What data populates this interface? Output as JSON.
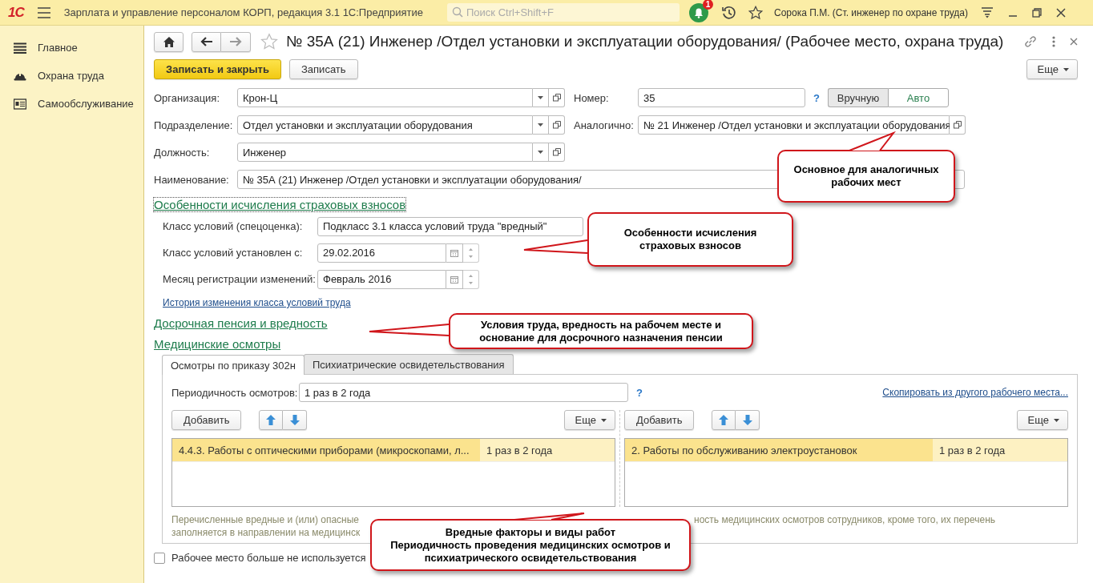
{
  "app_bar": {
    "logo": "1С",
    "title": "Зарплата и управление персоналом КОРП, редакция 3.1 1С:Предприятие",
    "search": {
      "placeholder": "Поиск Ctrl+Shift+F"
    },
    "notifications_badge": "1",
    "user": "Сорока П.М. (Ст. инженер по охране труда)"
  },
  "sidebar": {
    "items": [
      {
        "label": "Главное",
        "kind": "menu"
      },
      {
        "label": "Охрана труда",
        "kind": "helmet"
      },
      {
        "label": "Самообслуживание",
        "kind": "card"
      }
    ]
  },
  "form": {
    "title": "№ 35А (21) Инженер /Отдел установки и эксплуатации оборудования/ (Рабочее место, охрана труда)",
    "buttons": {
      "primary": "Записать и закрыть",
      "secondary": "Записать",
      "more": "Еще"
    },
    "fields": [
      {
        "label": "Организация:",
        "value": "Крон-Ц"
      },
      {
        "label": "Подразделение:",
        "value": "Отдел установки и эксплуатации оборудования"
      },
      {
        "label": "Должность:",
        "value": "Инженер"
      }
    ],
    "number": {
      "label": "Номер:",
      "value": "35",
      "help": "?",
      "modes": [
        {
          "label": "Вручную",
          "selected": false
        },
        {
          "label": "Авто",
          "selected": true
        }
      ]
    },
    "similar": {
      "label": "Аналогично:",
      "value": "№ 21 Инженер /Отдел установки и эксплуатации оборудования"
    },
    "name": {
      "label": "Наименование:",
      "value": "№ 35А (21) Инженер /Отдел установки и эксплуатации оборудования/"
    },
    "insurance": {
      "heading": "Особенности исчисления страховых взносов",
      "fields": [
        {
          "label": "Класс условий (спецоценка):",
          "value": "Подкласс 3.1 класса условий труда \"вредный\"",
          "kind": "text"
        },
        {
          "label": "Класс условий установлен с:",
          "value": "29.02.2016",
          "kind": "date"
        },
        {
          "label": "Месяц регистрации изменений:",
          "value": "Февраль 2016",
          "kind": "date"
        }
      ],
      "history_link": "История изменения класса условий труда"
    },
    "pension_heading": "Досрочная пенсия и вредность",
    "medical": {
      "heading": "Медицинские осмотры",
      "tabs": [
        {
          "label": "Осмотры по приказу 302н",
          "selected": true
        },
        {
          "label": "Психиатрические освидетельствования",
          "selected": false
        }
      ],
      "periodicity": {
        "label": "Периодичность осмотров:",
        "value": "1 раз в 2 года",
        "help": "?"
      },
      "copy_link": "Скопировать из другого рабочего места...",
      "tables": [
        {
          "add": "Добавить",
          "more": "Еще",
          "rows": [
            {
              "cells": [
                "4.4.3. Работы с оптическими приборами (микроскопами, л...",
                "1 раз в 2 года"
              ],
              "selected": true
            }
          ]
        },
        {
          "add": "Добавить",
          "more": "Еще",
          "rows": [
            {
              "cells": [
                "2. Работы по обслуживанию электроустановок",
                "1 раз в 2 года"
              ],
              "selected": true
            }
          ]
        }
      ],
      "hint_parts": [
        "Перечисленные вредные и (или) опасные",
        "ность медицинских осмотров сотрудников, кроме того, их перечень",
        "заполняется в направлении на медицинск"
      ]
    },
    "unused_checkbox": {
      "label": "Рабочее место больше не используется",
      "checked": false
    }
  },
  "callouts": [
    {
      "text": "Основное для аналогичных\nрабочих мест"
    },
    {
      "text": "Особенности исчисления\nстраховых взносов"
    },
    {
      "text": "Условия труда, вредность на рабочем месте и\nоснование для досрочного назначения пенсии"
    },
    {
      "text": "Вредные факторы и виды работ\nПериодичность проведения медицинских осмотров и\nпсихиатрического освидетельствования"
    }
  ]
}
